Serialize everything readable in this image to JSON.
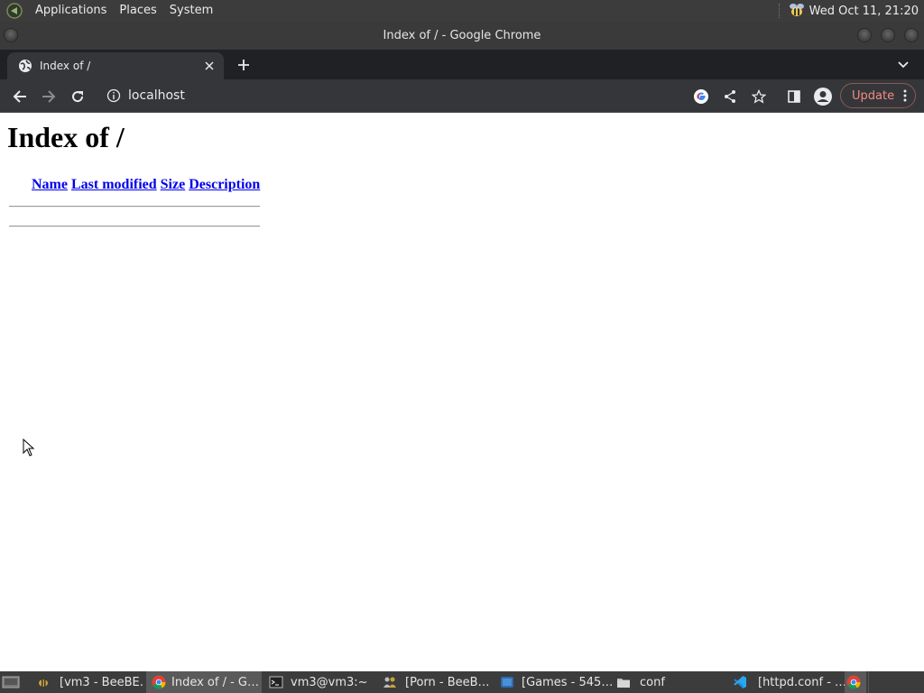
{
  "top_panel": {
    "menus": [
      "Applications",
      "Places",
      "System"
    ],
    "clock": "Wed Oct 11, 21:20"
  },
  "window": {
    "title": "Index of / - Google Chrome"
  },
  "tabs": [
    {
      "title": "Index of /",
      "active": true
    }
  ],
  "toolbar": {
    "url": "localhost",
    "update_label": "Update"
  },
  "page": {
    "heading": "Index of /",
    "columns": [
      "Name",
      "Last modified",
      "Size",
      "Description"
    ]
  },
  "taskbar": {
    "tasks": [
      {
        "label": "[vm3 - BeeBE…",
        "icon": "bee-icon"
      },
      {
        "label": "Index of / - G…",
        "icon": "chrome-icon",
        "active": true
      },
      {
        "label": "vm3@vm3:~",
        "icon": "terminal-icon"
      },
      {
        "label": "[Porn - BeeB…",
        "icon": "people-icon"
      },
      {
        "label": "[Games - 545…",
        "icon": "app-icon"
      },
      {
        "label": "conf",
        "icon": "folder-icon"
      },
      {
        "label": "[httpd.conf - …",
        "icon": "vscode-icon"
      }
    ]
  },
  "colors": {
    "link": "#0000ee",
    "panel_bg": "#3c3c3c",
    "chrome_toolbar": "#35363a",
    "update_accent": "#f28b82"
  }
}
